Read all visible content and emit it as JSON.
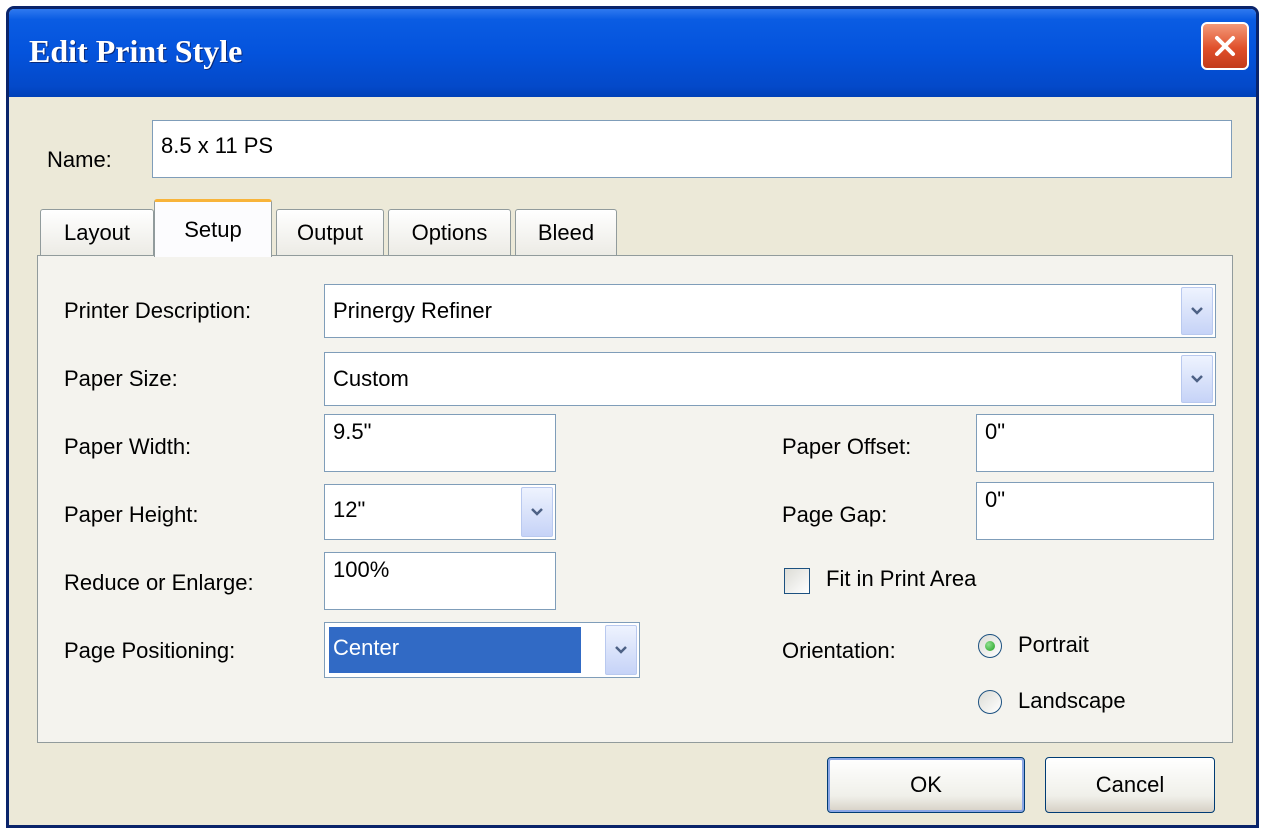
{
  "window": {
    "title": "Edit Print Style",
    "close_icon": "close-icon"
  },
  "name_field": {
    "label": "Name:",
    "value": "8.5 x 11 PS"
  },
  "tabs": [
    {
      "label": "Layout",
      "active": false
    },
    {
      "label": "Setup",
      "active": true
    },
    {
      "label": "Output",
      "active": false
    },
    {
      "label": "Options",
      "active": false
    },
    {
      "label": "Bleed",
      "active": false
    }
  ],
  "setup": {
    "printer_description": {
      "label": "Printer Description:",
      "value": "Prinergy Refiner"
    },
    "paper_size": {
      "label": "Paper Size:",
      "value": "Custom"
    },
    "paper_width": {
      "label": "Paper Width:",
      "value": "9.5\""
    },
    "paper_height": {
      "label": "Paper Height:",
      "value": "12\""
    },
    "reduce_enlarge": {
      "label": "Reduce or Enlarge:",
      "value": "100%"
    },
    "page_positioning": {
      "label": "Page Positioning:",
      "value": "Center"
    },
    "paper_offset": {
      "label": "Paper Offset:",
      "value": "0\""
    },
    "page_gap": {
      "label": "Page Gap:",
      "value": "0\""
    },
    "fit_in_print_area": {
      "label": "Fit in Print Area",
      "checked": false
    },
    "orientation": {
      "label": "Orientation:",
      "options": [
        {
          "label": "Portrait",
          "selected": true
        },
        {
          "label": "Landscape",
          "selected": false
        }
      ]
    }
  },
  "buttons": {
    "ok": "OK",
    "cancel": "Cancel"
  },
  "colors": {
    "titlebar": "#0453dc",
    "dialog_bg": "#ece9d8",
    "selection": "#316ac5",
    "active_tab_accent": "#f8b43a",
    "close_button": "#e0502b"
  }
}
